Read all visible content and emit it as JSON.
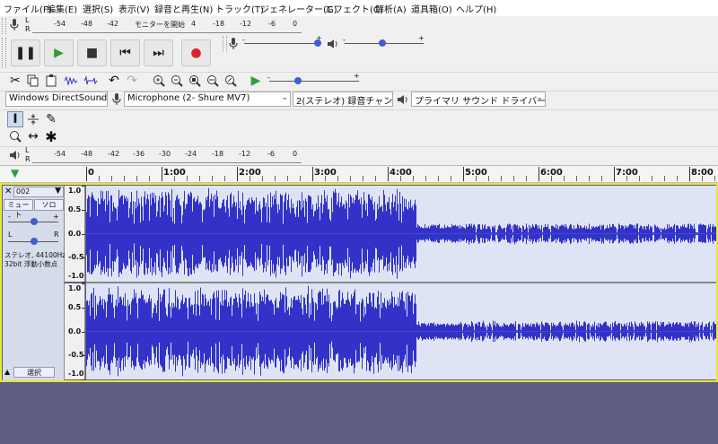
{
  "menu": [
    "ファイル(F)",
    "編集(E)",
    "選択(S)",
    "表示(V)",
    "録音と再生(N)",
    "トラック(T)",
    "ジェネレーター(G)",
    "エフェクト(C)",
    "解析(A)",
    "道具箱(O)",
    "ヘルプ(H)"
  ],
  "rec_meter": {
    "ticks": [
      "-54",
      "-48",
      "-42",
      "-18",
      "-12",
      "-6",
      "0"
    ],
    "monitor_label": "モニターを開始",
    "monitor_value": "4",
    "channels": [
      "L",
      "R"
    ]
  },
  "play_meter": {
    "ticks": [
      "-54",
      "-48",
      "-42",
      "-36",
      "-30",
      "-24",
      "-18",
      "-12",
      "-6",
      "0"
    ],
    "channels": [
      "L",
      "R"
    ]
  },
  "transport": {
    "buttons": [
      {
        "name": "pause-button",
        "glyph": "❚❚",
        "color": "#222"
      },
      {
        "name": "play-button",
        "glyph": "▶",
        "color": "#2e9e3a"
      },
      {
        "name": "stop-button",
        "glyph": "■",
        "color": "#333"
      },
      {
        "name": "skip-start-button",
        "glyph": "⏮",
        "color": "#222"
      },
      {
        "name": "skip-end-button",
        "glyph": "⏭",
        "color": "#222"
      },
      {
        "name": "record-button",
        "glyph": "●",
        "color": "#e0202a"
      }
    ]
  },
  "device": {
    "host": "Windows DirectSound",
    "mic": "Microphone (2- Shure MV7)",
    "channels": "2(ステレオ) 録音チャンネル",
    "output": "プライマリ サウンド ドライバー"
  },
  "ruler": {
    "labels": [
      "0",
      "1:00",
      "2:00",
      "3:00",
      "4:00",
      "5:00",
      "6:00",
      "7:00",
      "8:00"
    ]
  },
  "track": {
    "name": "002",
    "mute": "ミュート",
    "solo": "ソロ",
    "gain_minus": "-",
    "gain_plus": "+",
    "pan_left": "L",
    "pan_right": "R",
    "info_line1": "ステレオ, 44100Hz",
    "info_line2": "32bit 浮動小数点",
    "select_label": "選択",
    "y_labels": [
      "1.0",
      "0.5",
      "0.0",
      "-0.5",
      "-1.0"
    ]
  },
  "colors": {
    "waveform": "#3232c8",
    "wave_bg": "#dfe4f4",
    "selection_border": "#e8e830",
    "empty_area": "#5e5e82"
  }
}
